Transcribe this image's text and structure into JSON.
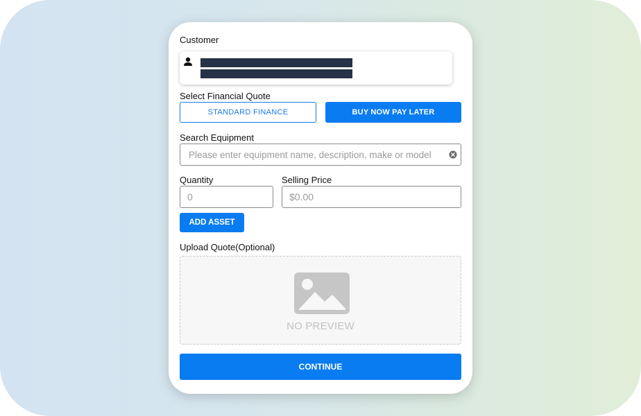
{
  "customer": {
    "label": "Customer",
    "icon": "user-icon"
  },
  "financial_quote": {
    "label": "Select Financial Quote",
    "options": [
      "STANDARD FINANCE",
      "BUY NOW PAY LATER"
    ],
    "selected": "BUY NOW PAY LATER"
  },
  "equipment": {
    "label": "Search Equipment",
    "placeholder": "Please enter equipment name, description, make or model",
    "clear_icon": "close-circle-icon"
  },
  "quantity": {
    "label": "Quantity",
    "placeholder": "0"
  },
  "selling_price": {
    "label": "Selling Price",
    "placeholder": "$0.00"
  },
  "add_asset_label": "ADD ASSET",
  "upload": {
    "label": "Upload Quote(Optional)",
    "preview_text": "NO PREVIEW",
    "icon": "image-placeholder-icon"
  },
  "continue_label": "CONTINUE",
  "colors": {
    "primary": "#0a7cf2",
    "redaction": "#263247"
  }
}
